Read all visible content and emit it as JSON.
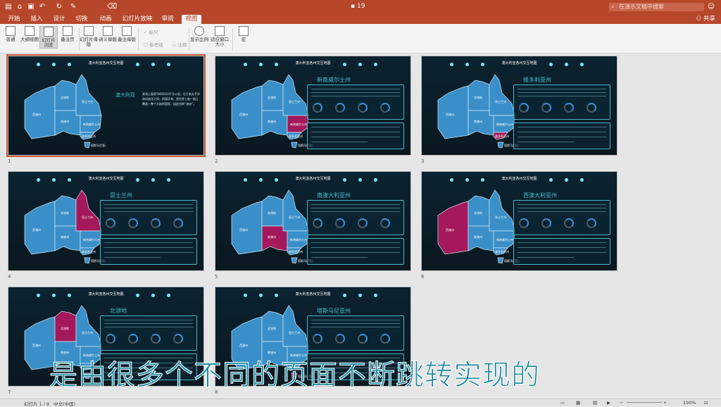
{
  "titlebar": {
    "doc_title": "19",
    "search_placeholder": "在演示文稿中搜索"
  },
  "tabs": [
    "开始",
    "插入",
    "设计",
    "切换",
    "动画",
    "幻灯片放映",
    "审阅",
    "视图"
  ],
  "active_tab": "视图",
  "share_label": "共享",
  "ribbon": {
    "buttons": [
      "普通",
      "大纲视图",
      "幻灯片浏览",
      "备注页",
      "幻灯片母版",
      "讲义母版",
      "备注母版",
      "显示比例",
      "适应窗口大小",
      "宏"
    ],
    "checks": [
      "标尺",
      "参考线",
      "注释"
    ]
  },
  "slides": [
    {
      "number": "1",
      "title": "澳大利亚各州交互地图",
      "state": "澳大利亚",
      "intro": "其领土面积7692024平方公里，位于南太平洋和印度洋之间，四面环海，是世界上唯一国土覆盖一整个大陆的国家，因此也称“澳洲”。"
    },
    {
      "number": "2",
      "title": "澳大利亚各州交互地图",
      "state": "新南威尔士州"
    },
    {
      "number": "3",
      "title": "澳大利亚各州交互地图",
      "state": "维多利亚州"
    },
    {
      "number": "4",
      "title": "澳大利亚各州交互地图",
      "state": "昆士兰州"
    },
    {
      "number": "5",
      "title": "澳大利亚各州交互地图",
      "state": "南澳大利亚州"
    },
    {
      "number": "6",
      "title": "澳大利亚各州交互地图",
      "state": "西澳大利亚州"
    },
    {
      "number": "7",
      "title": "澳大利亚各州交互地图",
      "state": "北领地"
    },
    {
      "number": "8",
      "title": "澳大利亚各州交互地图",
      "state": "塔斯马尼亚州"
    }
  ],
  "map_labels": {
    "wa": "西澳州",
    "nt": "北领地",
    "qld": "昆士兰州",
    "sa": "南澳州",
    "nsw": "新南威尔士州",
    "vic": "维多利亚州",
    "tas": "塔斯马尼亚州"
  },
  "caption": "是由很多个不同的页面不断跳转实现的",
  "statusbar": {
    "slide_info": "幻灯片 1 / 8",
    "language": "中文(中国)",
    "zoom": "190%"
  },
  "colors": {
    "accent": "#b7472a",
    "highlight": "#a3195b",
    "teal": "#49c1cf"
  }
}
